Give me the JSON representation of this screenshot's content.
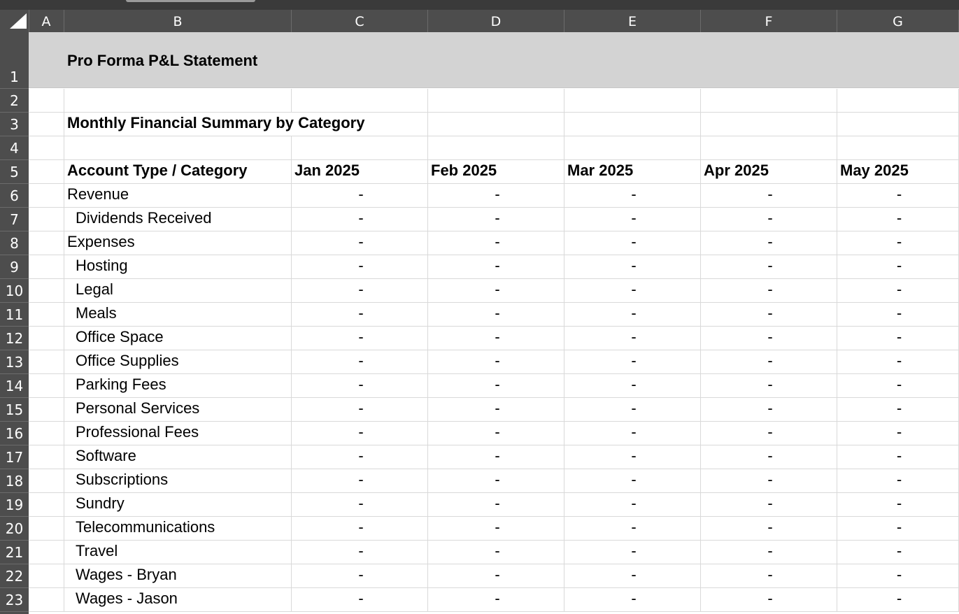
{
  "spreadsheet": {
    "columns": [
      "A",
      "B",
      "C",
      "D",
      "E",
      "F",
      "G"
    ],
    "rows": [
      "1",
      "2",
      "3",
      "4",
      "5",
      "6",
      "7",
      "8",
      "9",
      "10",
      "11",
      "12",
      "13",
      "14",
      "15",
      "16",
      "17",
      "18",
      "19",
      "20",
      "21",
      "22",
      "23"
    ],
    "title": "Pro Forma P&L Statement",
    "subtitle": "Monthly Financial Summary by Category",
    "header": {
      "label": "Account Type / Category",
      "months": [
        "Jan 2025",
        "Feb 2025",
        "Mar 2025",
        "Apr 2025",
        "May 2025"
      ]
    },
    "line_items": [
      {
        "label": "Revenue",
        "values": [
          "-",
          "-",
          "-",
          "-",
          "-"
        ]
      },
      {
        "label": "Dividends Received",
        "values": [
          "-",
          "-",
          "-",
          "-",
          "-"
        ]
      },
      {
        "label": "Expenses",
        "values": [
          "-",
          "-",
          "-",
          "-",
          "-"
        ]
      },
      {
        "label": "Hosting",
        "values": [
          "-",
          "-",
          "-",
          "-",
          "-"
        ]
      },
      {
        "label": "Legal",
        "values": [
          "-",
          "-",
          "-",
          "-",
          "-"
        ]
      },
      {
        "label": "Meals",
        "values": [
          "-",
          "-",
          "-",
          "-",
          "-"
        ]
      },
      {
        "label": "Office Space",
        "values": [
          "-",
          "-",
          "-",
          "-",
          "-"
        ]
      },
      {
        "label": "Office Supplies",
        "values": [
          "-",
          "-",
          "-",
          "-",
          "-"
        ]
      },
      {
        "label": "Parking Fees",
        "values": [
          "-",
          "-",
          "-",
          "-",
          "-"
        ]
      },
      {
        "label": "Personal Services",
        "values": [
          "-",
          "-",
          "-",
          "-",
          "-"
        ]
      },
      {
        "label": "Professional Fees",
        "values": [
          "-",
          "-",
          "-",
          "-",
          "-"
        ]
      },
      {
        "label": "Software",
        "values": [
          "-",
          "-",
          "-",
          "-",
          "-"
        ]
      },
      {
        "label": "Subscriptions",
        "values": [
          "-",
          "-",
          "-",
          "-",
          "-"
        ]
      },
      {
        "label": "Sundry",
        "values": [
          "-",
          "-",
          "-",
          "-",
          "-"
        ]
      },
      {
        "label": "Telecommunications",
        "values": [
          "-",
          "-",
          "-",
          "-",
          "-"
        ]
      },
      {
        "label": "Travel",
        "values": [
          "-",
          "-",
          "-",
          "-",
          "-"
        ]
      },
      {
        "label": "Wages - Bryan",
        "values": [
          "-",
          "-",
          "-",
          "-",
          "-"
        ]
      },
      {
        "label": "Wages - Jason",
        "values": [
          "-",
          "-",
          "-",
          "-",
          "-"
        ]
      }
    ]
  },
  "colors": {
    "header_bg": "#4d4d4d",
    "title_band": "#d3d3d3",
    "gridline": "#d9d9d9"
  }
}
